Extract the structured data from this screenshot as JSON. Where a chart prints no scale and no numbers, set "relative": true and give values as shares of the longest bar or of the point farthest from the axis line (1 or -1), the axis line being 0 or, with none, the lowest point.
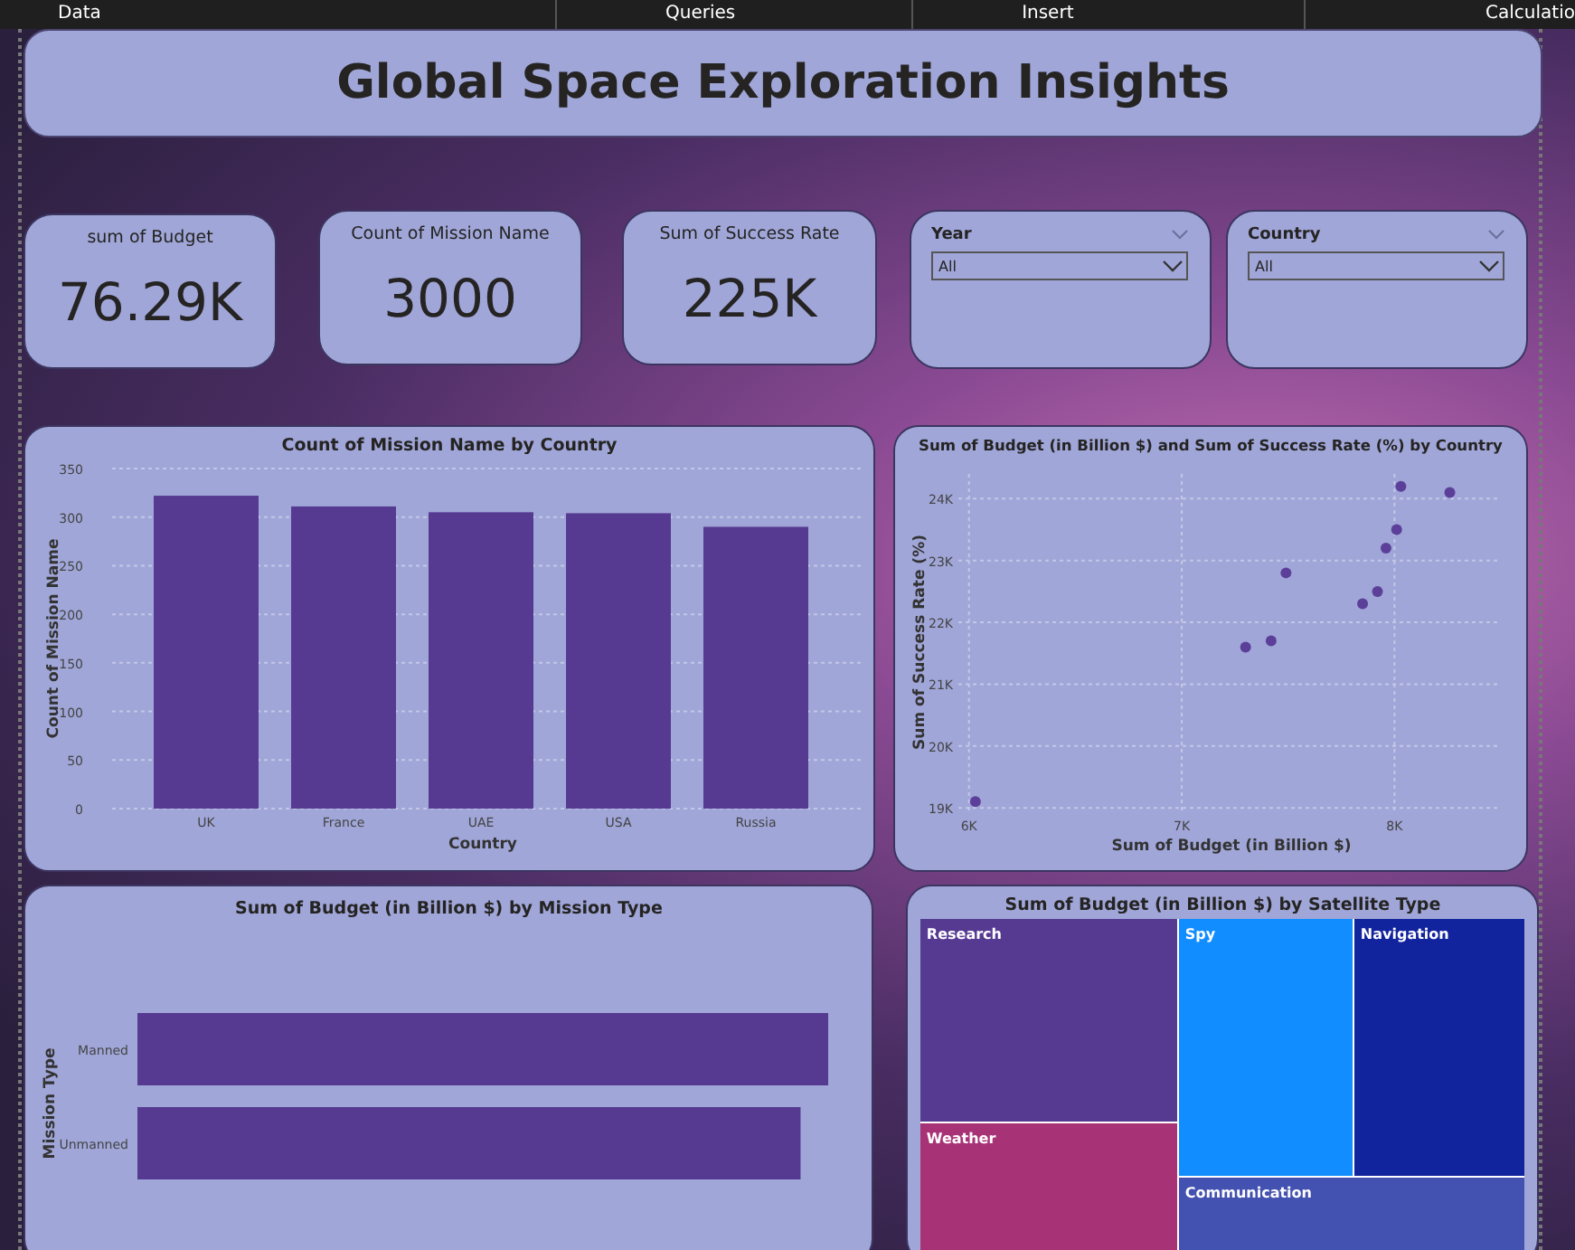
{
  "menu_bar": {
    "items": [
      "Data",
      "Queries",
      "Insert",
      "Calculatio"
    ]
  },
  "title": "Global Space Exploration Insights",
  "kpis": [
    {
      "label": "sum of Budget",
      "value": "76.29K"
    },
    {
      "label": "Count of Mission Name",
      "value": "3000"
    },
    {
      "label": "Sum of Success Rate",
      "value": "225K"
    }
  ],
  "slicers": [
    {
      "label": "Year",
      "value": "All"
    },
    {
      "label": "Country",
      "value": "All"
    }
  ],
  "bar_chart": {
    "chart_data": {
      "type": "bar",
      "title": "Count of Mission Name by Country",
      "xlabel": "Country",
      "ylabel": "Count of Mission Name",
      "categories": [
        "UK",
        "France",
        "UAE",
        "USA",
        "Russia"
      ],
      "series": [
        {
          "color": "#563a92",
          "values": [
            322,
            311,
            305,
            304,
            290
          ]
        }
      ],
      "grid": true,
      "ylim": [
        0,
        350
      ],
      "yticks": [
        0,
        50,
        100,
        150,
        200,
        250,
        300,
        350
      ]
    }
  },
  "scatter_chart": {
    "chart_data": {
      "type": "scatter",
      "title": "Sum of Budget (in Billion $) and Sum of Success Rate (%) by Country",
      "xlabel": "Sum of Budget (in Billion $)",
      "ylabel": "Sum of Success Rate (%)",
      "x": [
        6030,
        7300,
        7420,
        7490,
        7850,
        7920,
        7960,
        8010,
        8030,
        8260
      ],
      "series": [
        {
          "color": "#5c3f99",
          "values": [
            19100,
            21600,
            21700,
            22800,
            22300,
            22500,
            23200,
            23500,
            24200,
            24100
          ]
        }
      ],
      "grid": true,
      "xlim": [
        5950,
        8500
      ],
      "ylim": [
        18900,
        24400
      ],
      "xticks": [
        {
          "value": 6000,
          "label": "6K"
        },
        {
          "value": 7000,
          "label": "7K"
        },
        {
          "value": 8000,
          "label": "8K"
        }
      ],
      "yticks": [
        {
          "value": 19000,
          "label": "19K"
        },
        {
          "value": 20000,
          "label": "20K"
        },
        {
          "value": 21000,
          "label": "21K"
        },
        {
          "value": 22000,
          "label": "22K"
        },
        {
          "value": 23000,
          "label": "23K"
        },
        {
          "value": 24000,
          "label": "24K"
        }
      ]
    }
  },
  "hbar_chart": {
    "chart_data": {
      "type": "bar",
      "orientation": "horizontal",
      "title": "Sum of Budget (in Billion $) by Mission Type",
      "ylabel": "Mission Type",
      "categories": [
        "Manned",
        "Unmanned"
      ],
      "series": [
        {
          "color": "#563a92",
          "values": [
            1,
            0.96
          ]
        }
      ],
      "relative": true
    }
  },
  "treemap": {
    "title": "Sum of Budget (in Billion $) by Satellite Type",
    "tiles": [
      {
        "label": "Research",
        "color": "#563a92"
      },
      {
        "label": "Weather",
        "color": "#a83276"
      },
      {
        "label": "Spy",
        "color": "#118dff"
      },
      {
        "label": "Navigation",
        "color": "#12239e"
      },
      {
        "label": "Communication",
        "color": "#4351b0"
      }
    ]
  }
}
